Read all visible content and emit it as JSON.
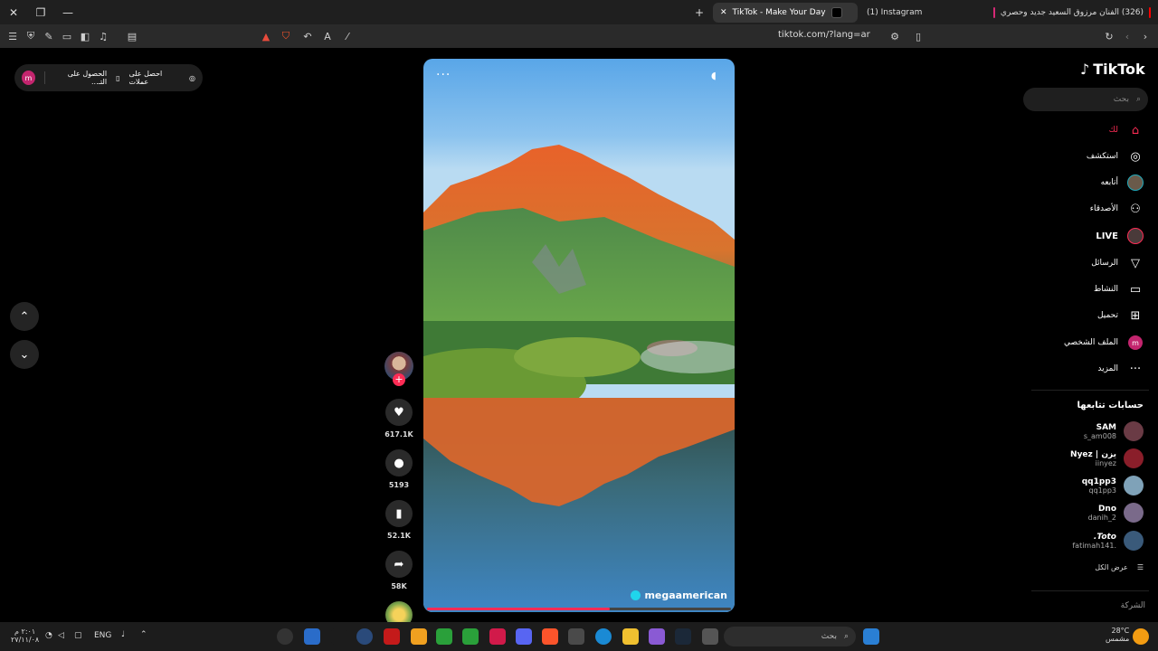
{
  "browser": {
    "tabs": [
      {
        "title": "TikTok - Make Your Day"
      },
      {
        "title": "(1) Instagram"
      },
      {
        "title": "(326) الفنان مرزوق السعيد جديد وحصري"
      }
    ],
    "url": "tiktok.com/?lang=ar"
  },
  "page": {
    "get_app": {
      "avatar_letter": "m",
      "get_coins": "احصل على عملات",
      "get_app": "الحصول على التـ..."
    },
    "video": {
      "author": "megaamerican",
      "more": "···",
      "progress": 0.6
    },
    "actions": {
      "likes": "617.1K",
      "comments": "5193",
      "saves": "52.1K",
      "shares": "58K"
    }
  },
  "sidebar": {
    "logo": "TikTok",
    "search_placeholder": "بحث",
    "nav": [
      {
        "label": "لك",
        "icon": "home-icon"
      },
      {
        "label": "استكشف",
        "icon": "compass-icon"
      },
      {
        "label": "أتابعه",
        "icon": "following-avatar-icon"
      },
      {
        "label": "الأصدقاء",
        "icon": "friends-icon"
      },
      {
        "label": "LIVE",
        "icon": "live-icon"
      },
      {
        "label": "الرسائل",
        "icon": "messages-icon"
      },
      {
        "label": "النشاط",
        "icon": "activity-icon"
      },
      {
        "label": "تحميل",
        "icon": "upload-icon"
      },
      {
        "label": "الملف الشخصي",
        "icon": "profile-icon"
      },
      {
        "label": "المزيد",
        "icon": "more-icon"
      }
    ],
    "following_title": "حسابات تتابعها",
    "accounts": [
      {
        "name": "SAM",
        "username": "s_am008",
        "color": "#6a3b45"
      },
      {
        "name": "Nyez | يزن",
        "username": "iinyez",
        "color": "#8a1e2a"
      },
      {
        "name": "qq1pp3",
        "username": "qq1pp3",
        "color": "#7fa2b8"
      },
      {
        "name": "Dno",
        "username": "danih_2",
        "color": "#7a6a8a"
      },
      {
        "name": ".Toto",
        "username": "fatimah141.",
        "color": "#3a5a7a"
      }
    ],
    "see_all": "عرض الكل",
    "company": "الشركة"
  },
  "taskbar": {
    "time": "٢:٠١ م",
    "date": "٢٧/١١/٠٨",
    "lang": "ENG",
    "search_placeholder": "بحث",
    "weather_temp": "28°C",
    "weather_desc": "مشمس"
  },
  "colors": {
    "accent": "#fe2c55",
    "verified": "#20d5ec"
  }
}
